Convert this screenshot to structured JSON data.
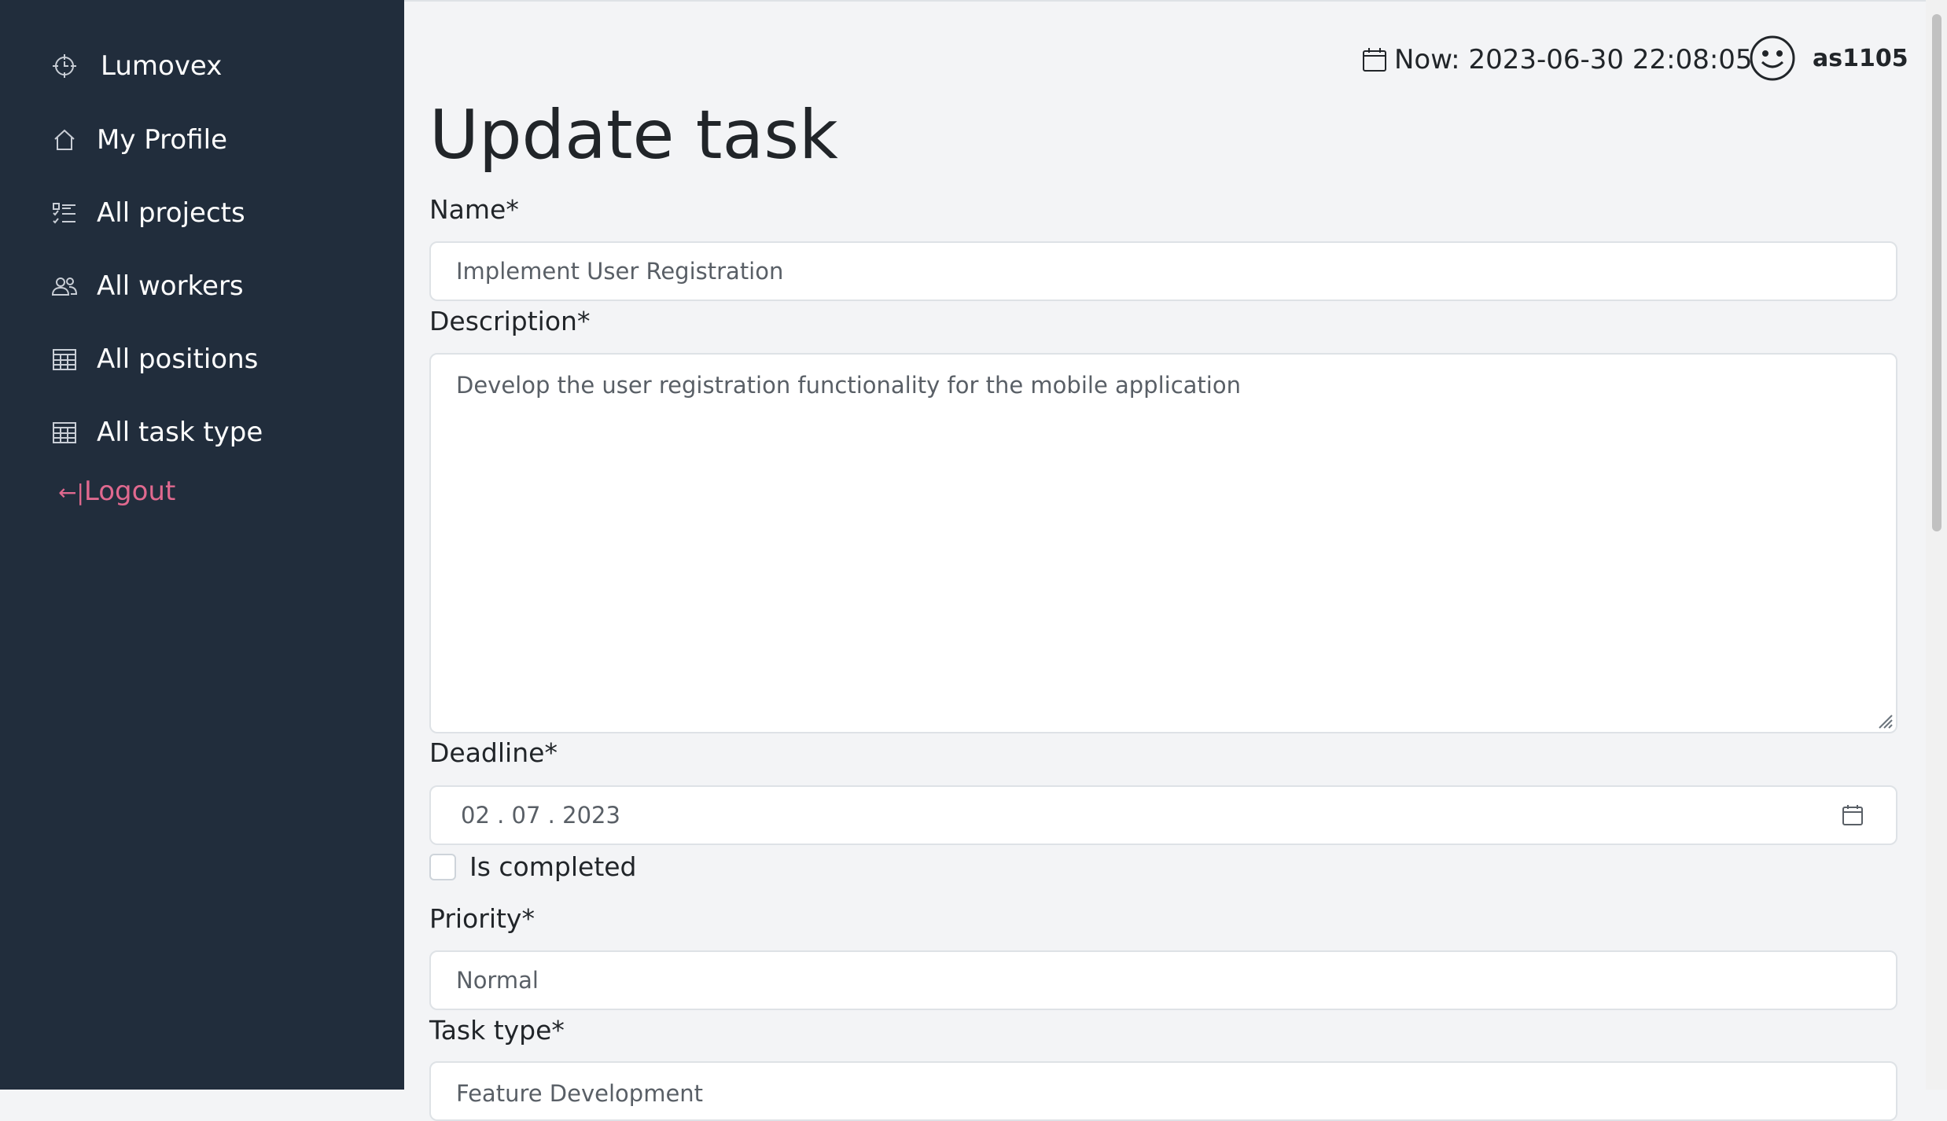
{
  "sidebar": {
    "brand": "Lumovex",
    "items": [
      {
        "label": "My Profile",
        "icon": "home-icon"
      },
      {
        "label": "All projects",
        "icon": "checklist-icon"
      },
      {
        "label": "All workers",
        "icon": "people-icon"
      },
      {
        "label": "All positions",
        "icon": "table-icon"
      },
      {
        "label": "All task type",
        "icon": "table-icon"
      }
    ],
    "logout_icon": "←|",
    "logout_label": "Logout"
  },
  "topbar": {
    "now_label": "Now: 2023-06-30 22:08:05",
    "username": "as1105"
  },
  "form": {
    "title": "Update task",
    "name_label": "Name*",
    "name_value": "Implement User Registration",
    "description_label": "Description*",
    "description_value": "Develop the user registration functionality for the mobile application",
    "deadline_label": "Deadline*",
    "deadline_value": "02 . 07 . 2023",
    "completed_label": "Is completed",
    "completed_checked": false,
    "priority_label": "Priority*",
    "priority_value": "Normal",
    "task_type_label": "Task type*",
    "task_type_value": "Feature Development"
  },
  "colors": {
    "sidebar_bg": "#212d3c",
    "main_bg": "#f3f4f6",
    "logout": "#e0698f",
    "text": "#212529"
  }
}
